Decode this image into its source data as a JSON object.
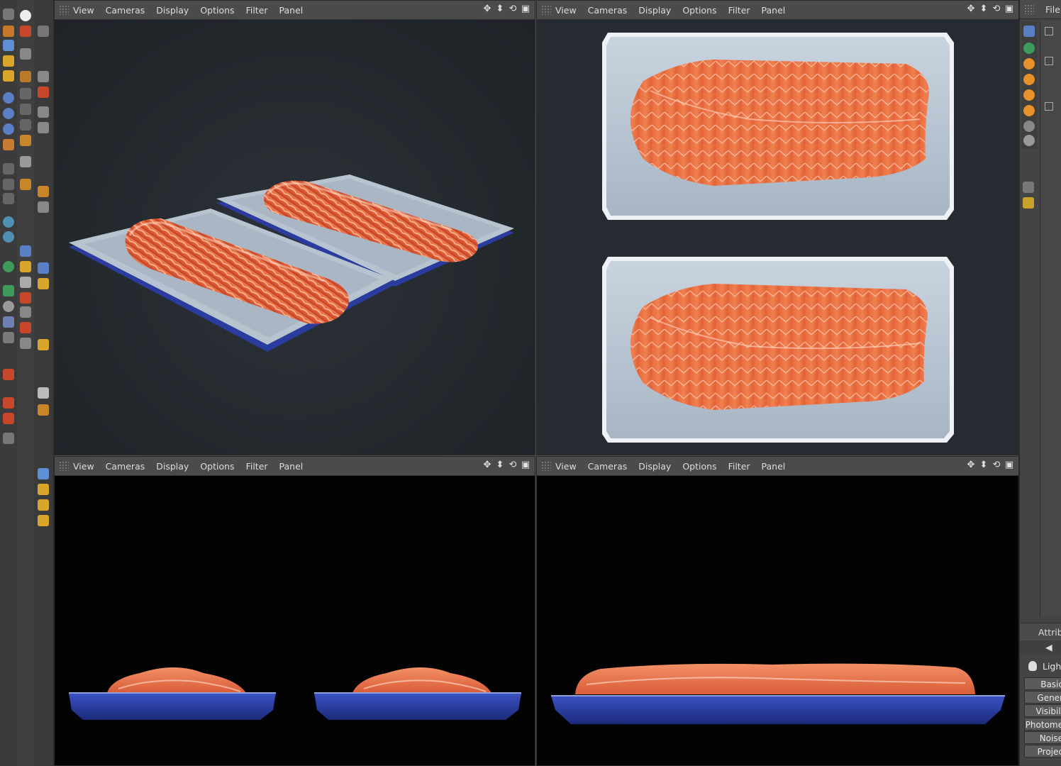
{
  "viewport_menu": [
    "View",
    "Cameras",
    "Display",
    "Options",
    "Filter",
    "Panel"
  ],
  "viewports": [
    {
      "id": "perspective",
      "menu": [
        "View",
        "Cameras",
        "Display",
        "Options",
        "Filter",
        "Panel"
      ]
    },
    {
      "id": "top",
      "menu": [
        "View",
        "Cameras",
        "Display",
        "Options",
        "Filter",
        "Panel"
      ]
    },
    {
      "id": "front",
      "menu": [
        "View",
        "Cameras",
        "Display",
        "Options",
        "Filter",
        "Panel"
      ]
    },
    {
      "id": "right",
      "menu": [
        "View",
        "Cameras",
        "Display",
        "Options",
        "Filter",
        "Panel"
      ]
    }
  ],
  "nav_icons": [
    "move-view-icon",
    "zoom-view-icon",
    "rotate-view-icon",
    "toggle-view-icon"
  ],
  "right_panel": {
    "menu": "File",
    "attributes_label": "Attrib",
    "light_label": "Ligh",
    "tabs": [
      "Basic",
      "Gener",
      "Visibili",
      "Photome",
      "Noise",
      "Projec"
    ]
  },
  "colors": {
    "viewport_bg_top": "#262b31",
    "viewport_bg_black": "#030303",
    "salmon": "#e8623a",
    "tray": "#a7b5c4",
    "tray_rim": "#2b3fa0",
    "menubar": "#4b4b4b"
  }
}
